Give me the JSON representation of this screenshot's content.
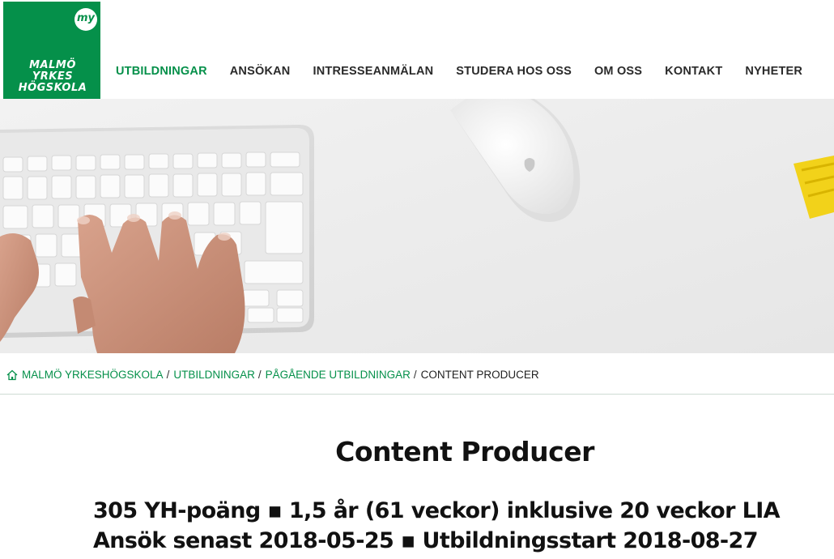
{
  "logo": {
    "badge": "my",
    "line1": "MALMÖ",
    "line2": "YRKES",
    "line3": "HÖGSKOLA"
  },
  "nav": {
    "items": [
      {
        "label": "UTBILDNINGAR",
        "active": true
      },
      {
        "label": "ANSÖKAN"
      },
      {
        "label": "INTRESSEANMÄLAN"
      },
      {
        "label": "STUDERA HOS OSS"
      },
      {
        "label": "OM OSS"
      },
      {
        "label": "KONTAKT"
      },
      {
        "label": "NYHETER"
      }
    ]
  },
  "hero": {
    "icons": [
      "keyboard",
      "hands",
      "mouse",
      "yellow-watch-strap"
    ]
  },
  "breadcrumb": {
    "home_icon": "home-icon",
    "items": [
      {
        "label": "MALMÖ YRKESHÖGSKOLA"
      },
      {
        "label": "UTBILDNINGAR"
      },
      {
        "label": "PÅGÅENDE UTBILDNINGAR"
      }
    ],
    "separator": "/",
    "current": "CONTENT PRODUCER"
  },
  "page": {
    "title": "Content Producer",
    "facts_line1": "305 YH-poäng ▪ 1,5 år (61 veckor) inklusive 20 veckor LIA",
    "facts_line2": "Ansök senast 2018-05-25 ▪ Utbildningsstart 2018-08-27"
  },
  "colors": {
    "brand_green": "#05904a",
    "text_dark": "#1e1e1e"
  }
}
